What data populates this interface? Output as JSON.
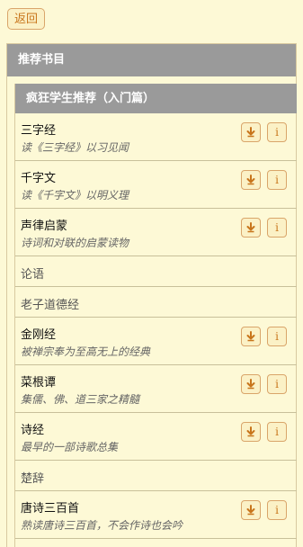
{
  "topbar": {
    "back_label": "返回"
  },
  "section": {
    "title": "推荐书目"
  },
  "subsection": {
    "title": "疯狂学生推荐（入门篇）"
  },
  "icons": {
    "download": "download-arrow-icon",
    "info": "info-icon"
  },
  "colors": {
    "accent": "#c8751b",
    "header_bg": "#9a9a9a",
    "page_bg": "#fdf9d6"
  },
  "items": [
    {
      "title": "三字经",
      "desc": "读《三字经》以习见闻",
      "has_actions": true
    },
    {
      "title": "千字文",
      "desc": "读《千字文》以明义理",
      "has_actions": true
    },
    {
      "title": "声律启蒙",
      "desc": "诗词和对联的启蒙读物",
      "has_actions": true
    },
    {
      "title": "论语",
      "desc": "",
      "has_actions": false
    },
    {
      "title": "老子道德经",
      "desc": "",
      "has_actions": false
    },
    {
      "title": "金刚经",
      "desc": "被禅宗奉为至高无上的经典",
      "has_actions": true
    },
    {
      "title": "菜根谭",
      "desc": "集儒、佛、道三家之精髓",
      "has_actions": true
    },
    {
      "title": "诗经",
      "desc": "最早的一部诗歌总集",
      "has_actions": true
    },
    {
      "title": "楚辞",
      "desc": "",
      "has_actions": false
    },
    {
      "title": "唐诗三百首",
      "desc": "熟读唐诗三百首，不会作诗也会吟",
      "has_actions": true
    }
  ]
}
